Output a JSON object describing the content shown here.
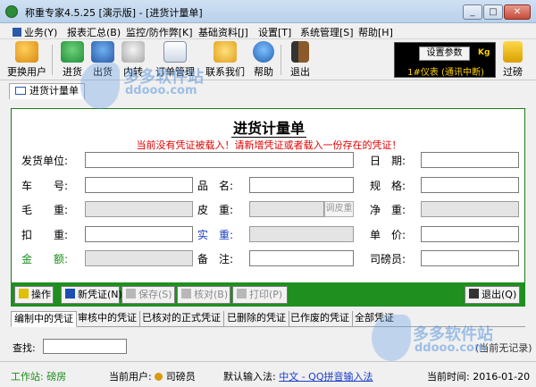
{
  "window": {
    "title": "称重专家4.5.25 [演示版] - [进货计量单]",
    "minimize": "_",
    "maximize": "□",
    "close": "✕"
  },
  "menu": [
    "业务(Y)",
    "报表汇总(B)",
    "监控/防作弊[K]",
    "基础资料[J]",
    "设置[T]",
    "系统管理[S]",
    "帮助[H]"
  ],
  "toolbar": {
    "buttons": [
      "更换用户",
      "进货",
      "出货",
      "内转",
      "订单管理",
      "联系我们",
      "帮助",
      "退出"
    ],
    "settings_label": "设置参数",
    "unit": "Kg",
    "meter_status": "1#仪表 (通讯中断)",
    "tare_button": "过磅"
  },
  "doc_tab": "进货计量单",
  "form": {
    "title": "进货计量单",
    "warning": "当前没有凭证被载入！请新增凭证或者载入一份存在的凭证！",
    "labels": {
      "supplier": "发货单位:",
      "date": "日　期:",
      "vehicle": "车　　号:",
      "product": "品　名:",
      "spec": "规　格:",
      "gross": "毛　　重:",
      "tare": "皮　重:",
      "net": "净　重:",
      "deduct": "扣　　重:",
      "actual": "实　重:",
      "price": "单　价:",
      "amount": "金　　额:",
      "remark": "备　注:",
      "operator": "司磅员:"
    },
    "tare_adjust": "调皮重"
  },
  "command_bar": [
    "操作",
    "新凭证(N)",
    "保存(S)",
    "核对(B)",
    "打印(P)",
    "退出(Q)"
  ],
  "tabs": [
    "编制中的凭证",
    "审核中的凭证",
    "已核对的正式凭证",
    "已删除的凭证",
    "已作废的凭证",
    "全部凭证"
  ],
  "search": {
    "label": "查找:",
    "value": "",
    "status": "(当前无记录)"
  },
  "statusbar": {
    "workstation_label": "工作站:",
    "workstation": "磅房",
    "user_label": "当前用户:",
    "user": "司磅员",
    "input_label": "默认输入法:",
    "input": "中文 - QQ拼音输入法",
    "time_label": "当前时间:",
    "time": "2016-01-20"
  },
  "watermark": {
    "brand": "多多软件站",
    "url": "ddooo.com"
  },
  "colors": {
    "form_border": "#1d7a1d",
    "command_bar": "#1f8f1f",
    "warning": "#e00000",
    "label_green": "#1a8c1a",
    "label_blue": "#1a3cc8"
  }
}
